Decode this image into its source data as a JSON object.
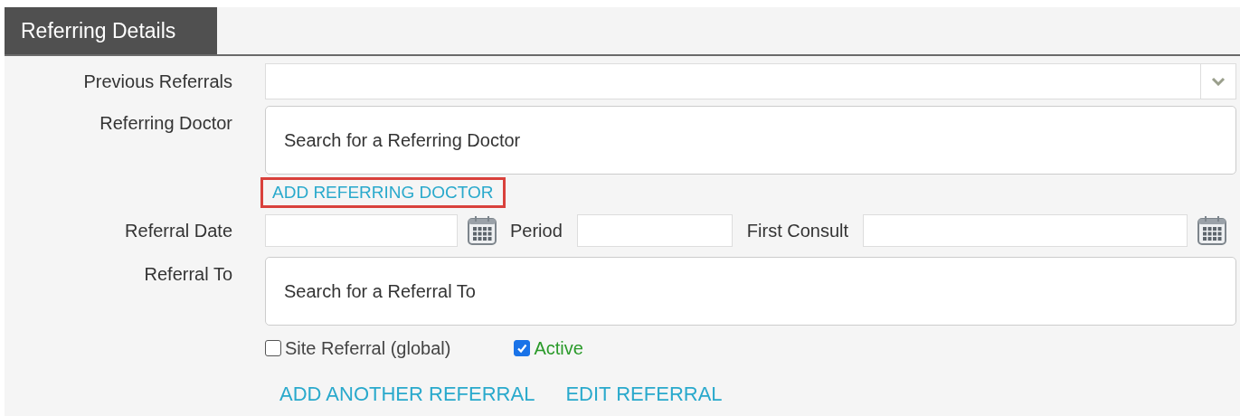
{
  "section_tab": "Referring Details",
  "previous_referrals": {
    "label": "Previous Referrals"
  },
  "referring_doctor": {
    "label": "Referring Doctor",
    "placeholder": "Search for a Referring Doctor"
  },
  "add_doctor_link": {
    "label": "ADD REFERRING DOCTOR",
    "highlighted": true
  },
  "date_row": {
    "label": "Referral Date",
    "period_label": "Period",
    "first_consult_label": "First Consult"
  },
  "referral_to": {
    "label": "Referral To",
    "placeholder": "Search for a Referral To"
  },
  "checkboxes": [
    {
      "label": "Site Referral (global)",
      "checked": false
    },
    {
      "label": "Active",
      "checked": true
    }
  ],
  "links": [
    "ADD ANOTHER REFERRAL",
    "EDIT REFERRAL"
  ]
}
